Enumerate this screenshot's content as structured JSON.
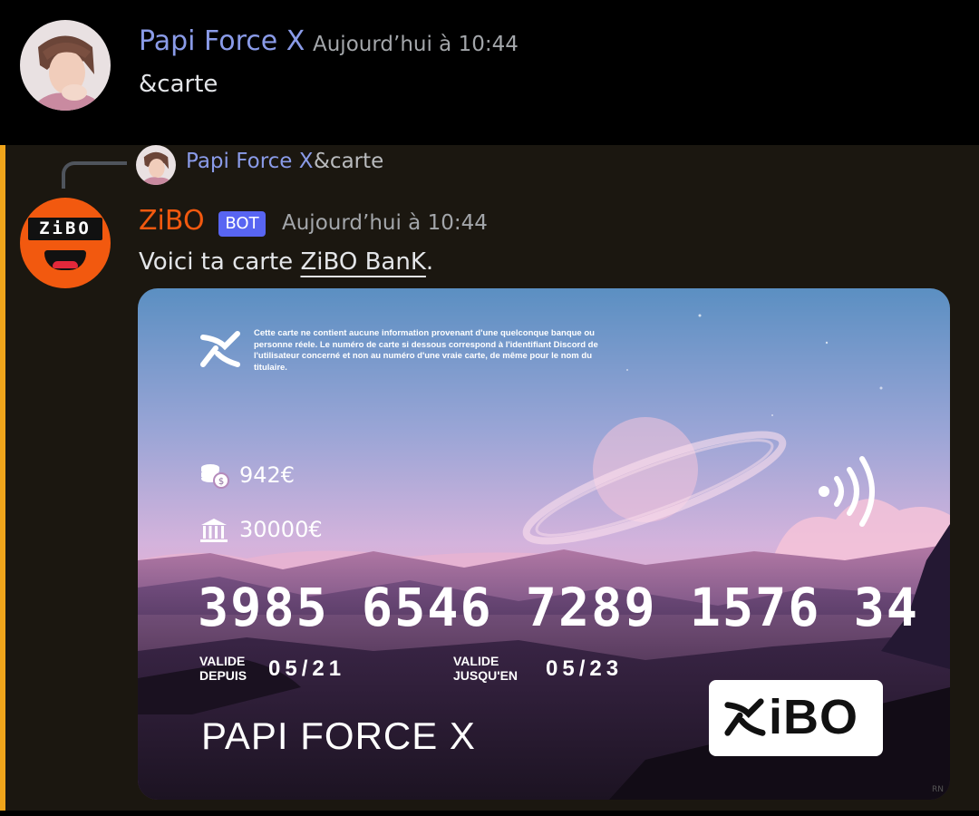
{
  "message1": {
    "author": "Papi Force X",
    "timestamp": "Aujourd’hui à 10:44",
    "content": "&carte"
  },
  "message2": {
    "reply": {
      "author": "Papi Force X",
      "content": "&carte"
    },
    "author": "ZiBO",
    "badge": "BOT",
    "timestamp": "Aujourd’hui à 10:44",
    "content_prefix": "Voici ta carte ",
    "content_link": "ZiBO BanK",
    "content_suffix": ".",
    "accent_color": "#f0a51b",
    "author_color": "#f2590f",
    "avatar_text": "ZiBO"
  },
  "card": {
    "disclaimer": "Cette carte ne contient aucune information provenant d'une quelconque banque ou personne réele. Le numéro de carte si dessous correspond à l'identifiant Discord de l'utilisateur concerné et non au numéro d'une vraie carte, de même pour le nom du titulaire.",
    "balance": "942€",
    "savings": "30000€",
    "number": "3985 6546 7289 1576 34",
    "valid_from_label_1": "VALIDE",
    "valid_from_label_2": "DEPUIS",
    "valid_from": "05/21",
    "valid_to_label_1": "VALIDE",
    "valid_to_label_2": "JUSQU'EN",
    "valid_to": "05/23",
    "holder": "PAPI FORCE X",
    "brand": "iBO",
    "corner_mark": "RN",
    "icons": [
      "x-logo-icon",
      "coins-icon",
      "bank-icon",
      "contactless-icon",
      "zibo-logo-icon"
    ]
  }
}
